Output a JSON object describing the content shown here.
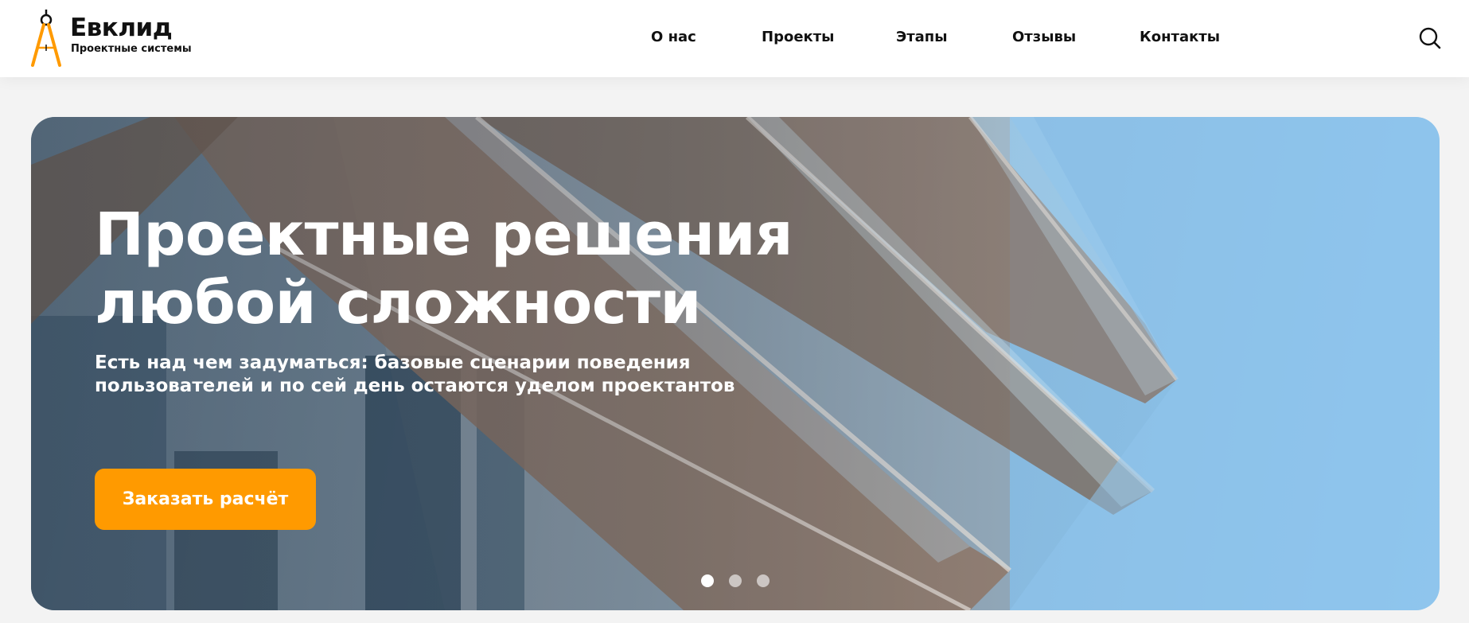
{
  "brand": {
    "title": "Евклид",
    "subtitle": "Проектные системы",
    "logo_icon": "compass-icon",
    "accent_color": "#ff9a00"
  },
  "nav": {
    "items": [
      {
        "label": "О нас"
      },
      {
        "label": "Проекты"
      },
      {
        "label": "Этапы"
      },
      {
        "label": "Отзывы"
      },
      {
        "label": "Контакты"
      }
    ],
    "search_icon": "search-icon"
  },
  "hero": {
    "title_line1": "Проектные решения",
    "title_line2": "любой сложности",
    "description_line1": "Есть над чем задуматься: базовые сценарии поведения",
    "description_line2": "пользователей и по сей день остаются уделом проектантов",
    "cta_label": "Заказать расчёт",
    "slides_total": 3,
    "active_slide": 1
  }
}
